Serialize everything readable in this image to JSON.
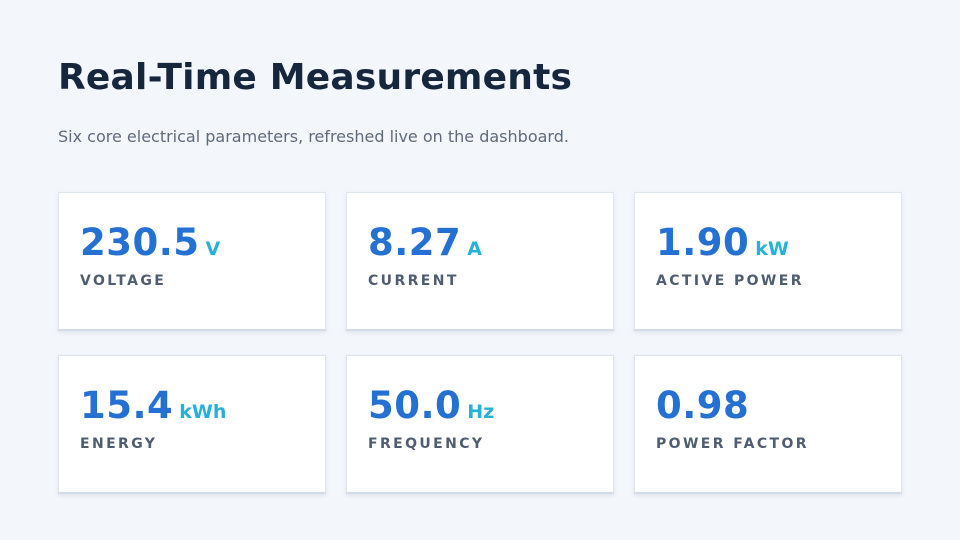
{
  "header": {
    "title": "Real-Time Measurements",
    "subtitle": "Six core electrical parameters, refreshed live on the dashboard."
  },
  "metrics": [
    {
      "value": "230.5",
      "unit": "V",
      "label": "VOLTAGE"
    },
    {
      "value": "8.27",
      "unit": "A",
      "label": "CURRENT"
    },
    {
      "value": "1.90",
      "unit": "kW",
      "label": "ACTIVE POWER"
    },
    {
      "value": "15.4",
      "unit": "kWh",
      "label": "ENERGY"
    },
    {
      "value": "50.0",
      "unit": "Hz",
      "label": "FREQUENCY"
    },
    {
      "value": "0.98",
      "unit": "",
      "label": "POWER FACTOR"
    }
  ],
  "colors": {
    "background": "#f3f6fb",
    "title": "#16263d",
    "value": "#2470d3",
    "unit": "#27b1d9",
    "label": "#4f5d70"
  }
}
